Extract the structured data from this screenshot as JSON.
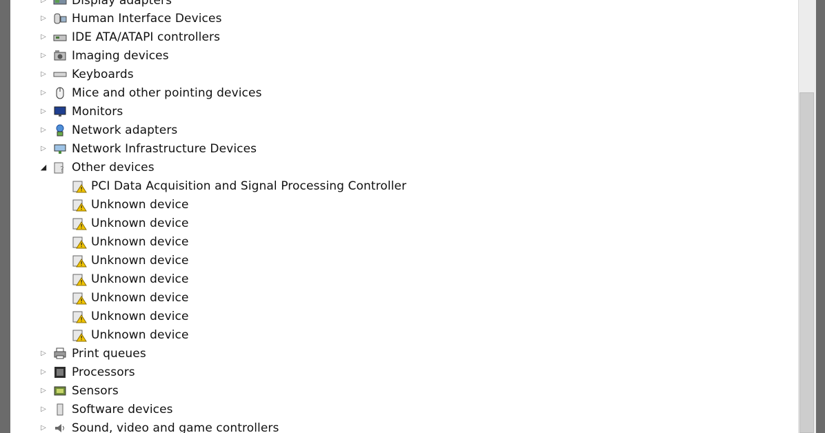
{
  "tree": {
    "partial_top": {
      "label": "Display adapters",
      "icon": "display-adapter-icon"
    },
    "categories": [
      {
        "label": "Human Interface Devices",
        "icon": "hid-icon"
      },
      {
        "label": "IDE ATA/ATAPI controllers",
        "icon": "ide-controller-icon"
      },
      {
        "label": "Imaging devices",
        "icon": "camera-icon"
      },
      {
        "label": "Keyboards",
        "icon": "keyboard-icon"
      },
      {
        "label": "Mice and other pointing devices",
        "icon": "mouse-icon"
      },
      {
        "label": "Monitors",
        "icon": "monitor-icon"
      },
      {
        "label": "Network adapters",
        "icon": "network-adapter-icon"
      },
      {
        "label": "Network Infrastructure Devices",
        "icon": "network-infrastructure-icon"
      },
      {
        "label": "Other devices",
        "icon": "other-devices-icon"
      }
    ],
    "other_devices_children": [
      {
        "label": "PCI Data Acquisition and Signal Processing Controller",
        "icon": "warning-device-icon"
      },
      {
        "label": "Unknown device",
        "icon": "warning-device-icon"
      },
      {
        "label": "Unknown device",
        "icon": "warning-device-icon"
      },
      {
        "label": "Unknown device",
        "icon": "warning-device-icon"
      },
      {
        "label": "Unknown device",
        "icon": "warning-device-icon"
      },
      {
        "label": "Unknown device",
        "icon": "warning-device-icon"
      },
      {
        "label": "Unknown device",
        "icon": "warning-device-icon"
      },
      {
        "label": "Unknown device",
        "icon": "warning-device-icon"
      },
      {
        "label": "Unknown device",
        "icon": "warning-device-icon"
      }
    ],
    "after": [
      {
        "label": "Print queues",
        "icon": "printer-icon"
      },
      {
        "label": "Processors",
        "icon": "processor-icon"
      },
      {
        "label": "Sensors",
        "icon": "sensor-icon"
      },
      {
        "label": "Software devices",
        "icon": "software-device-icon"
      },
      {
        "label": "Sound, video and game controllers",
        "icon": "speaker-icon"
      }
    ]
  },
  "colors": {
    "warning": "#f2c500",
    "accent": "#1f5fbf",
    "text": "#111111"
  }
}
